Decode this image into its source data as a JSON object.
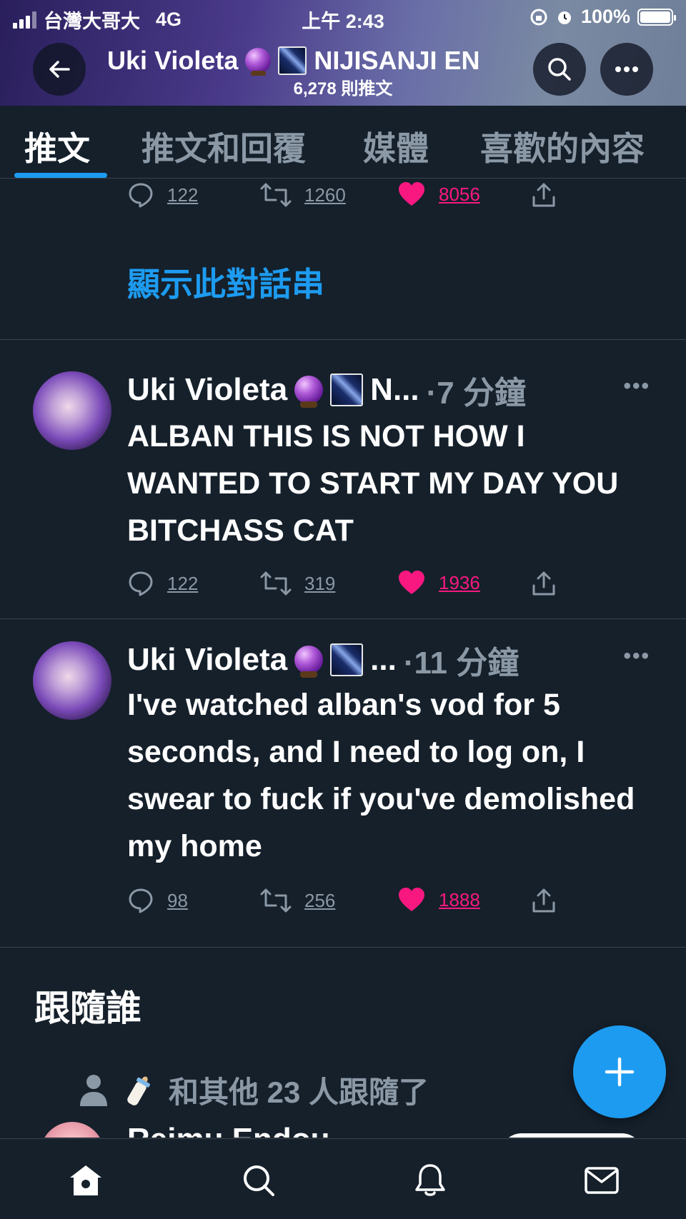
{
  "status_bar": {
    "carrier": "台灣大哥大",
    "network": "4G",
    "time": "上午 2:43",
    "battery": "100%"
  },
  "header": {
    "name": "Uki Violeta",
    "org": "NIJISANJI EN",
    "tweet_count": "6,278 則推文"
  },
  "tabs": [
    {
      "label": "推文",
      "active": true
    },
    {
      "label": "推文和回覆",
      "active": false
    },
    {
      "label": "媒體",
      "active": false
    },
    {
      "label": "喜歡的內容",
      "active": false
    }
  ],
  "tweets": [
    {
      "show_thread": "顯示此對話串",
      "stats": {
        "replies": "122",
        "retweets": "1260",
        "likes": "8056"
      }
    },
    {
      "name": "Uki Violeta",
      "name_suffix": "N...",
      "time": "·7 分鐘",
      "text": "ALBAN THIS IS NOT HOW I WANTED TO START MY DAY YOU BITCHASS CAT",
      "stats": {
        "replies": "122",
        "retweets": "319",
        "likes": "1936"
      }
    },
    {
      "name": "Uki Violeta",
      "name_suffix": "...",
      "time": "·11 分鐘",
      "text": "I've watched alban's vod for 5 seconds, and I need to log on, I swear to fuck if you've demolished my home",
      "stats": {
        "replies": "98",
        "retweets": "256",
        "likes": "1888"
      }
    }
  ],
  "who_to_follow": {
    "title": "跟隨誰",
    "followed_by": "和其他 23 人跟隨了",
    "partial_name": "Reimu Endou"
  },
  "colors": {
    "background": "#15202b",
    "accent": "#1d9bf0",
    "like": "#f91880",
    "muted": "#8b98a5"
  },
  "icons": [
    "back-arrow-icon",
    "search-icon",
    "more-icon",
    "reply-icon",
    "retweet-icon",
    "heart-icon",
    "share-icon",
    "compose-plus-icon",
    "home-icon",
    "bell-icon",
    "mail-icon"
  ]
}
